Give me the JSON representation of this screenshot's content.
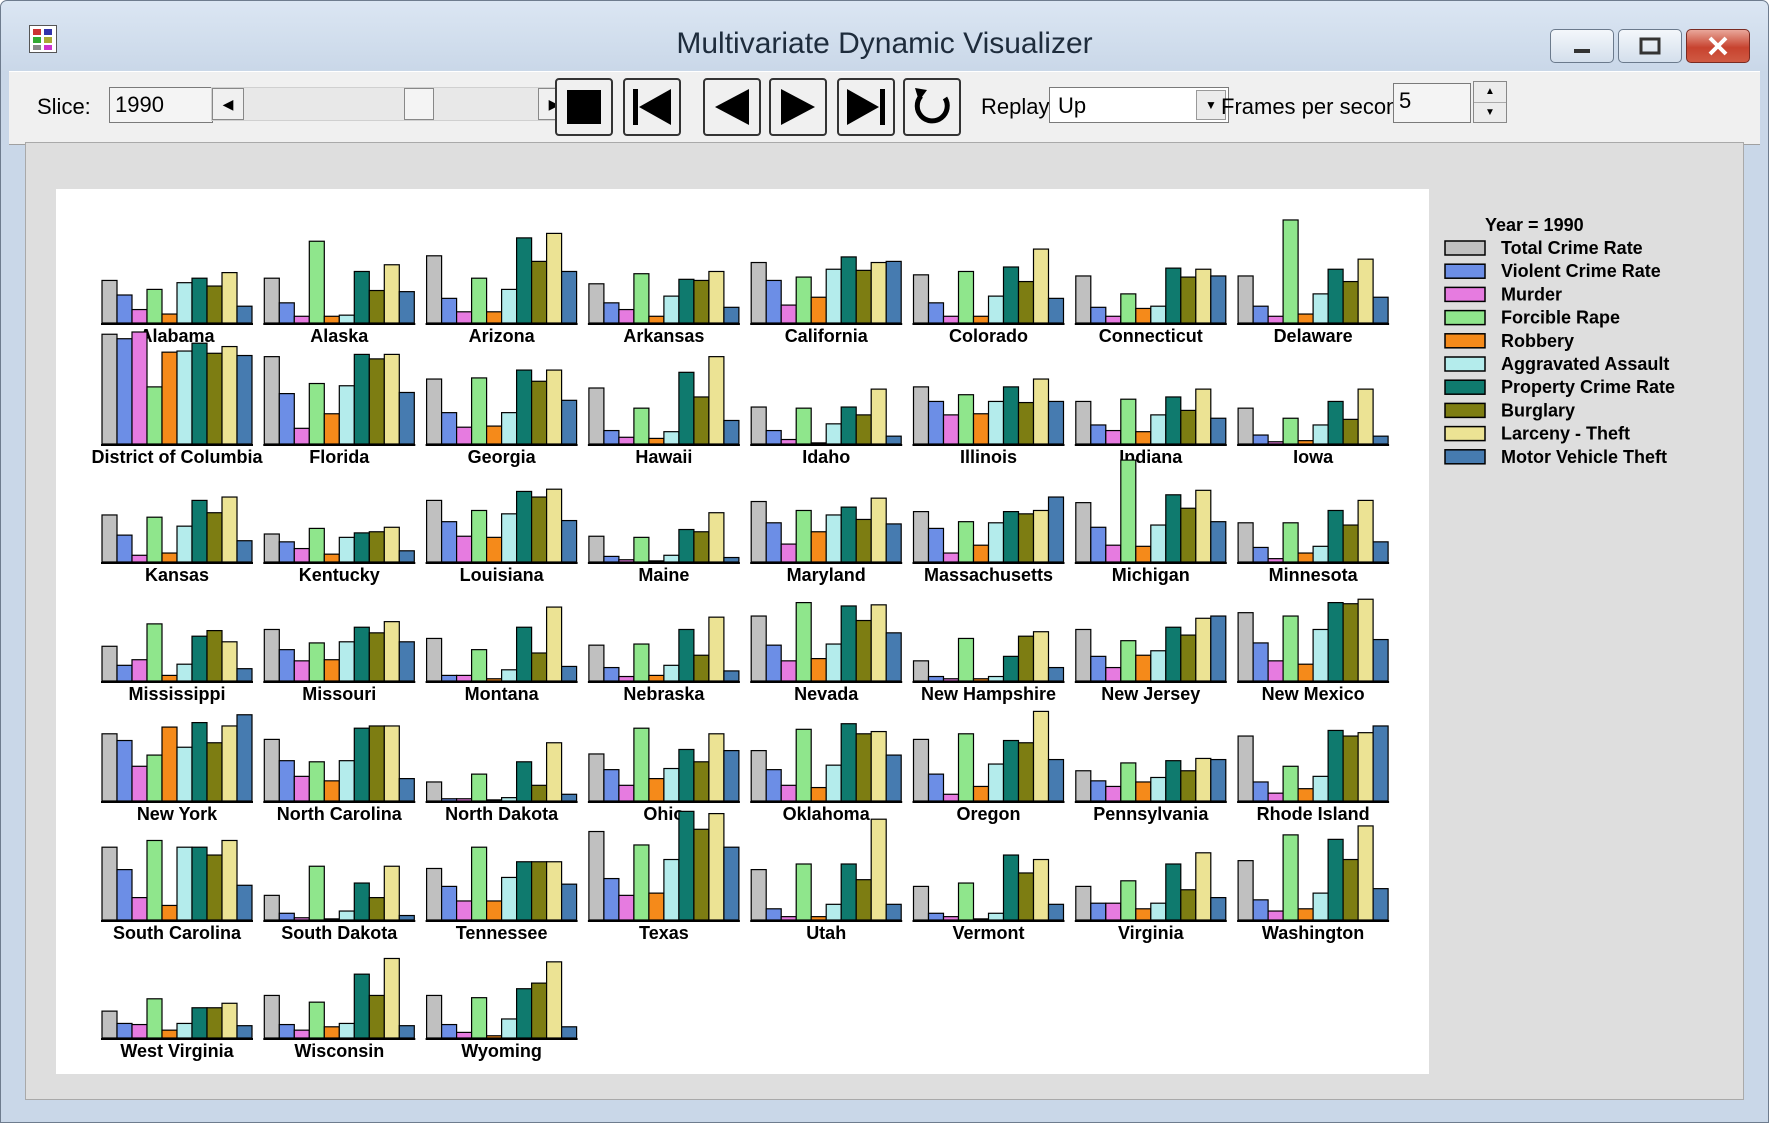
{
  "window": {
    "title": "Multivariate Dynamic Visualizer"
  },
  "toolbar": {
    "slice_label": "Slice:",
    "slice_value": "1990",
    "replay_label": "Replay:",
    "replay_value": "Up",
    "fps_label": "Frames per second:",
    "fps_value": "5",
    "slider_position": 0.6
  },
  "legend": {
    "title": "Year = 1990",
    "items": [
      {
        "label": "Total Crime Rate",
        "color": "#c0c0c0"
      },
      {
        "label": "Violent Crime Rate",
        "color": "#6c8ee6"
      },
      {
        "label": "Murder",
        "color": "#e67be0"
      },
      {
        "label": "Forcible Rape",
        "color": "#8fe68c"
      },
      {
        "label": "Robbery",
        "color": "#f58a1a"
      },
      {
        "label": "Aggravated Assault",
        "color": "#b4ecec"
      },
      {
        "label": "Property Crime Rate",
        "color": "#0f7a6e"
      },
      {
        "label": "Burglary",
        "color": "#7d7d12"
      },
      {
        "label": "Larceny - Theft",
        "color": "#ece394"
      },
      {
        "label": "Motor Vehicle Theft",
        "color": "#467bb0"
      }
    ]
  },
  "chart_data": {
    "type": "bar",
    "title": "Year = 1990",
    "variables": [
      "Total Crime Rate",
      "Violent Crime Rate",
      "Murder",
      "Forcible Rape",
      "Robbery",
      "Aggravated Assault",
      "Property Crime Rate",
      "Burglary",
      "Larceny - Theft",
      "Motor Vehicle Theft"
    ],
    "scale": [
      0,
      1
    ],
    "states": [
      {
        "name": "Alabama",
        "values": [
          0.38,
          0.25,
          0.12,
          0.3,
          0.08,
          0.36,
          0.4,
          0.33,
          0.45,
          0.15
        ]
      },
      {
        "name": "Alaska",
        "values": [
          0.4,
          0.18,
          0.06,
          0.73,
          0.06,
          0.07,
          0.46,
          0.29,
          0.52,
          0.28
        ]
      },
      {
        "name": "Arizona",
        "values": [
          0.6,
          0.22,
          0.1,
          0.4,
          0.1,
          0.3,
          0.76,
          0.55,
          0.8,
          0.46
        ]
      },
      {
        "name": "Arkansas",
        "values": [
          0.35,
          0.18,
          0.12,
          0.44,
          0.06,
          0.24,
          0.39,
          0.38,
          0.46,
          0.14
        ]
      },
      {
        "name": "California",
        "values": [
          0.54,
          0.38,
          0.16,
          0.41,
          0.23,
          0.48,
          0.59,
          0.47,
          0.54,
          0.55
        ]
      },
      {
        "name": "Colorado",
        "values": [
          0.43,
          0.18,
          0.06,
          0.46,
          0.06,
          0.24,
          0.5,
          0.37,
          0.66,
          0.22
        ]
      },
      {
        "name": "Connecticut",
        "values": [
          0.42,
          0.14,
          0.06,
          0.26,
          0.13,
          0.15,
          0.49,
          0.41,
          0.48,
          0.42
        ]
      },
      {
        "name": "Delaware",
        "values": [
          0.42,
          0.15,
          0.06,
          0.92,
          0.08,
          0.26,
          0.48,
          0.37,
          0.57,
          0.23
        ]
      },
      {
        "name": "District of Columbia",
        "values": [
          0.98,
          0.94,
          1.0,
          0.51,
          0.82,
          0.83,
          0.9,
          0.81,
          0.87,
          0.79
        ]
      },
      {
        "name": "Florida",
        "values": [
          0.78,
          0.45,
          0.14,
          0.54,
          0.27,
          0.52,
          0.8,
          0.76,
          0.8,
          0.46
        ]
      },
      {
        "name": "Georgia",
        "values": [
          0.58,
          0.28,
          0.15,
          0.59,
          0.16,
          0.28,
          0.66,
          0.56,
          0.66,
          0.39
        ]
      },
      {
        "name": "Hawaii",
        "values": [
          0.5,
          0.12,
          0.06,
          0.32,
          0.05,
          0.11,
          0.64,
          0.42,
          0.78,
          0.21
        ]
      },
      {
        "name": "Idaho",
        "values": [
          0.33,
          0.12,
          0.04,
          0.32,
          0.01,
          0.18,
          0.33,
          0.26,
          0.49,
          0.07
        ]
      },
      {
        "name": "Illinois",
        "values": [
          0.51,
          0.38,
          0.26,
          0.44,
          0.27,
          0.38,
          0.51,
          0.37,
          0.58,
          0.38
        ]
      },
      {
        "name": "Indiana",
        "values": [
          0.38,
          0.17,
          0.12,
          0.4,
          0.11,
          0.26,
          0.42,
          0.3,
          0.49,
          0.23
        ]
      },
      {
        "name": "Iowa",
        "values": [
          0.32,
          0.08,
          0.02,
          0.23,
          0.03,
          0.17,
          0.38,
          0.22,
          0.49,
          0.07
        ]
      },
      {
        "name": "Kansas",
        "values": [
          0.42,
          0.24,
          0.06,
          0.4,
          0.08,
          0.32,
          0.55,
          0.44,
          0.58,
          0.19
        ]
      },
      {
        "name": "Kentucky",
        "values": [
          0.25,
          0.18,
          0.12,
          0.3,
          0.07,
          0.22,
          0.26,
          0.27,
          0.31,
          0.1
        ]
      },
      {
        "name": "Louisiana",
        "values": [
          0.55,
          0.36,
          0.23,
          0.46,
          0.22,
          0.43,
          0.63,
          0.58,
          0.65,
          0.37
        ]
      },
      {
        "name": "Maine",
        "values": [
          0.23,
          0.05,
          0.02,
          0.22,
          0.01,
          0.06,
          0.29,
          0.27,
          0.44,
          0.04
        ]
      },
      {
        "name": "Maryland",
        "values": [
          0.54,
          0.35,
          0.16,
          0.46,
          0.27,
          0.42,
          0.49,
          0.38,
          0.57,
          0.34
        ]
      },
      {
        "name": "Massachusetts",
        "values": [
          0.45,
          0.3,
          0.08,
          0.36,
          0.15,
          0.35,
          0.45,
          0.43,
          0.46,
          0.58
        ]
      },
      {
        "name": "Michigan",
        "values": [
          0.53,
          0.31,
          0.15,
          0.91,
          0.14,
          0.33,
          0.6,
          0.48,
          0.64,
          0.36
        ]
      },
      {
        "name": "Minnesota",
        "values": [
          0.35,
          0.13,
          0.03,
          0.35,
          0.08,
          0.14,
          0.46,
          0.33,
          0.55,
          0.18
        ]
      },
      {
        "name": "Mississippi",
        "values": [
          0.31,
          0.14,
          0.19,
          0.51,
          0.05,
          0.15,
          0.4,
          0.45,
          0.35,
          0.11
        ]
      },
      {
        "name": "Missouri",
        "values": [
          0.46,
          0.28,
          0.18,
          0.34,
          0.19,
          0.35,
          0.48,
          0.43,
          0.53,
          0.35
        ]
      },
      {
        "name": "Montana",
        "values": [
          0.38,
          0.05,
          0.05,
          0.28,
          0.02,
          0.1,
          0.48,
          0.25,
          0.66,
          0.13
        ]
      },
      {
        "name": "Nebraska",
        "values": [
          0.32,
          0.12,
          0.04,
          0.33,
          0.05,
          0.14,
          0.46,
          0.23,
          0.57,
          0.09
        ]
      },
      {
        "name": "Nevada",
        "values": [
          0.58,
          0.32,
          0.18,
          0.7,
          0.2,
          0.33,
          0.67,
          0.54,
          0.68,
          0.43
        ]
      },
      {
        "name": "New Hampshire",
        "values": [
          0.18,
          0.04,
          0.02,
          0.38,
          0.02,
          0.04,
          0.22,
          0.4,
          0.44,
          0.12
        ]
      },
      {
        "name": "New Jersey",
        "values": [
          0.46,
          0.22,
          0.12,
          0.36,
          0.23,
          0.27,
          0.48,
          0.41,
          0.56,
          0.58
        ]
      },
      {
        "name": "New Mexico",
        "values": [
          0.61,
          0.34,
          0.18,
          0.58,
          0.15,
          0.46,
          0.7,
          0.69,
          0.73,
          0.37
        ]
      },
      {
        "name": "New York",
        "values": [
          0.6,
          0.54,
          0.31,
          0.41,
          0.66,
          0.48,
          0.7,
          0.52,
          0.67,
          0.77
        ]
      },
      {
        "name": "North Carolina",
        "values": [
          0.55,
          0.36,
          0.22,
          0.35,
          0.18,
          0.36,
          0.65,
          0.67,
          0.67,
          0.2
        ]
      },
      {
        "name": "North Dakota",
        "values": [
          0.17,
          0.02,
          0.02,
          0.24,
          0.01,
          0.03,
          0.35,
          0.14,
          0.52,
          0.06
        ]
      },
      {
        "name": "Ohio",
        "values": [
          0.42,
          0.28,
          0.14,
          0.65,
          0.2,
          0.29,
          0.46,
          0.35,
          0.6,
          0.45
        ]
      },
      {
        "name": "Oklahoma",
        "values": [
          0.45,
          0.28,
          0.14,
          0.64,
          0.12,
          0.32,
          0.69,
          0.6,
          0.62,
          0.41
        ]
      },
      {
        "name": "Oregon",
        "values": [
          0.55,
          0.24,
          0.06,
          0.6,
          0.13,
          0.33,
          0.54,
          0.52,
          0.8,
          0.37
        ]
      },
      {
        "name": "Pennsylvania",
        "values": [
          0.27,
          0.18,
          0.13,
          0.34,
          0.17,
          0.21,
          0.36,
          0.27,
          0.38,
          0.37
        ]
      },
      {
        "name": "Rhode Island",
        "values": [
          0.58,
          0.17,
          0.07,
          0.31,
          0.11,
          0.22,
          0.63,
          0.58,
          0.61,
          0.67
        ]
      },
      {
        "name": "South Carolina",
        "values": [
          0.65,
          0.45,
          0.2,
          0.71,
          0.13,
          0.65,
          0.65,
          0.58,
          0.71,
          0.31
        ]
      },
      {
        "name": "South Dakota",
        "values": [
          0.22,
          0.06,
          0.02,
          0.48,
          0.01,
          0.08,
          0.33,
          0.2,
          0.48,
          0.04
        ]
      },
      {
        "name": "Tennessee",
        "values": [
          0.46,
          0.3,
          0.17,
          0.65,
          0.17,
          0.38,
          0.52,
          0.52,
          0.52,
          0.32
        ]
      },
      {
        "name": "Texas",
        "values": [
          0.79,
          0.37,
          0.22,
          0.67,
          0.24,
          0.54,
          0.97,
          0.81,
          0.95,
          0.65
        ]
      },
      {
        "name": "Utah",
        "values": [
          0.45,
          0.1,
          0.03,
          0.5,
          0.03,
          0.14,
          0.5,
          0.36,
          0.9,
          0.14
        ]
      },
      {
        "name": "Vermont",
        "values": [
          0.3,
          0.06,
          0.03,
          0.33,
          0.01,
          0.06,
          0.58,
          0.42,
          0.54,
          0.14
        ]
      },
      {
        "name": "Virginia",
        "values": [
          0.3,
          0.15,
          0.15,
          0.35,
          0.1,
          0.15,
          0.5,
          0.27,
          0.6,
          0.2
        ]
      },
      {
        "name": "Washington",
        "values": [
          0.53,
          0.18,
          0.08,
          0.76,
          0.1,
          0.24,
          0.72,
          0.54,
          0.84,
          0.28
        ]
      },
      {
        "name": "West Virginia",
        "values": [
          0.24,
          0.13,
          0.12,
          0.35,
          0.07,
          0.13,
          0.27,
          0.27,
          0.31,
          0.11
        ]
      },
      {
        "name": "Wisconsin",
        "values": [
          0.38,
          0.12,
          0.07,
          0.32,
          0.1,
          0.13,
          0.57,
          0.38,
          0.71,
          0.11
        ]
      },
      {
        "name": "Wyoming",
        "values": [
          0.38,
          0.12,
          0.05,
          0.36,
          0.02,
          0.17,
          0.44,
          0.49,
          0.68,
          0.1
        ]
      }
    ]
  }
}
